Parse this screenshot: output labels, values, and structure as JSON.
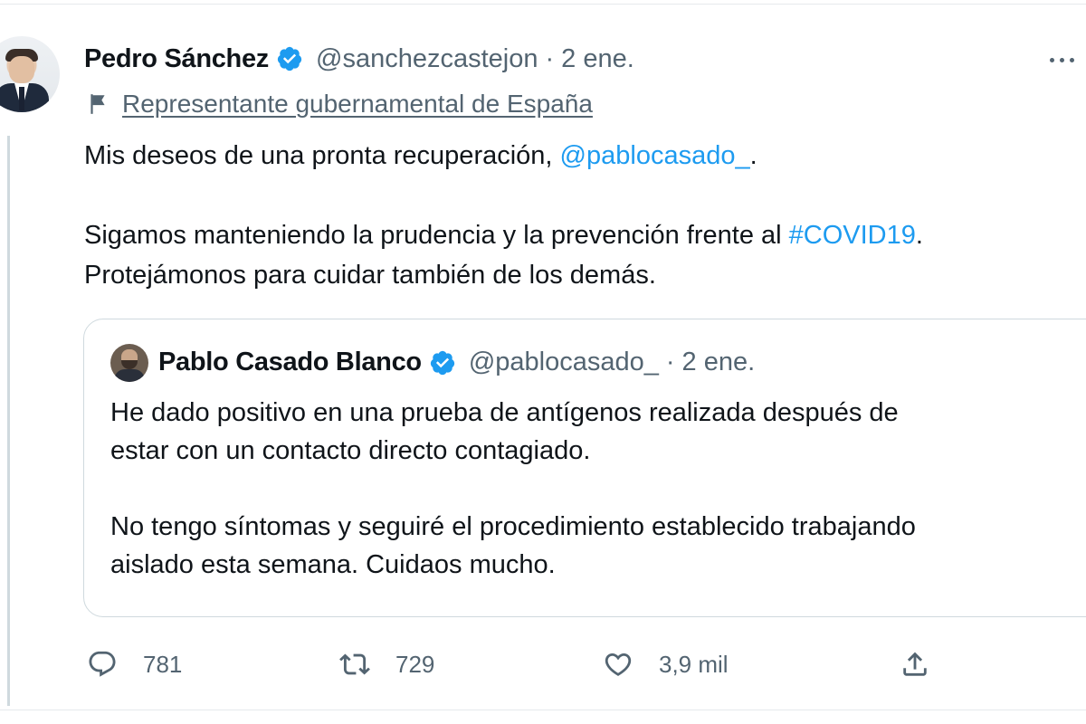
{
  "tweet": {
    "author": {
      "name": "Pedro Sánchez",
      "handle": "@sanchezcastejon",
      "separator": "·",
      "time": "2 ene."
    },
    "label": "Representante gubernamental de España",
    "text": {
      "line1_prefix": "Mis deseos de una pronta recuperación, ",
      "line1_mention": "@pablocasado_",
      "line1_suffix": ".",
      "para2_prefix": "Sigamos manteniendo la prudencia y la prevención frente al ",
      "para2_hashtag": "#COVID19",
      "para2_suffix": ".",
      "para2_line2": "Protejámonos para cuidar también de los demás."
    },
    "quote": {
      "name": "Pablo Casado Blanco",
      "handle": "@pablocasado_",
      "separator": "·",
      "time": "2 ene.",
      "line1": "He dado positivo en una prueba de antígenos realizada después de",
      "line2": "estar con un contacto directo contagiado.",
      "line3": "No tengo síntomas y seguiré el procedimiento establecido trabajando",
      "line4": "aislado esta semana. Cuidaos mucho."
    },
    "actions": {
      "replies": "781",
      "retweets": "729",
      "likes": "3,9 mil"
    }
  },
  "colors": {
    "text": "#0f1419",
    "secondary": "#536471",
    "link": "#1d9bf0",
    "verified": "#1d9bf0",
    "border": "#cfd9de"
  },
  "icons": {
    "verified": "verified-badge-icon",
    "more": "more-dots-icon",
    "flag": "flag-icon",
    "reply": "reply-bubble-icon",
    "retweet": "retweet-arrows-icon",
    "like": "heart-icon",
    "share": "share-upload-icon"
  }
}
